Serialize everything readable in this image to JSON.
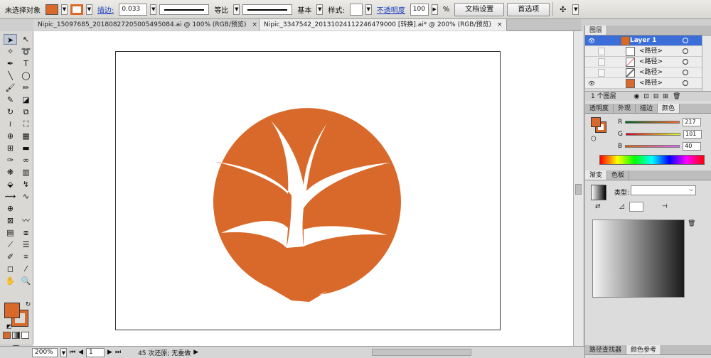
{
  "control_bar": {
    "selection_label": "未选择对象",
    "stroke_link": "描边:",
    "stroke_width": "0.033",
    "stroke_profile": "等比",
    "brush_label": "基本",
    "style_label": "样式:",
    "opacity_link": "不透明度",
    "opacity_value": "100",
    "opacity_unit": "%",
    "doc_setup_button": "文档设置",
    "preferences_button": "首选项",
    "fill_color": "#d9692a"
  },
  "tabs": [
    {
      "label": "Nipic_15097685_20180827205005495084.ai @ 100% (RGB/预览)",
      "close": "×"
    },
    {
      "label": "Nipic_3347542_20131024112246479000 [转换].ai* @ 200% (RGB/预览)",
      "close": "×"
    }
  ],
  "artwork": {
    "tree_color": "#d9692a"
  },
  "status_bar": {
    "zoom": "200%",
    "page": "1",
    "message": "45 次还原; 无重做"
  },
  "layers_panel": {
    "title": "图层",
    "rows": [
      {
        "name": "Layer 1"
      },
      {
        "name": "<路径>"
      },
      {
        "name": "<路径>"
      },
      {
        "name": "<路径>"
      },
      {
        "name": "<路径>"
      }
    ],
    "count": "1 个图层"
  },
  "color_panel": {
    "tabs": [
      "透明度",
      "外观",
      "描边",
      "颜色"
    ],
    "channels": [
      {
        "label": "R",
        "value": "217"
      },
      {
        "label": "G",
        "value": "101"
      },
      {
        "label": "B",
        "value": "40"
      }
    ]
  },
  "gradient_panel": {
    "tabs": [
      "渐变",
      "色板"
    ],
    "type_label": "类型:"
  },
  "bottom_tabs": [
    "路径查找器",
    "颜色参考"
  ]
}
